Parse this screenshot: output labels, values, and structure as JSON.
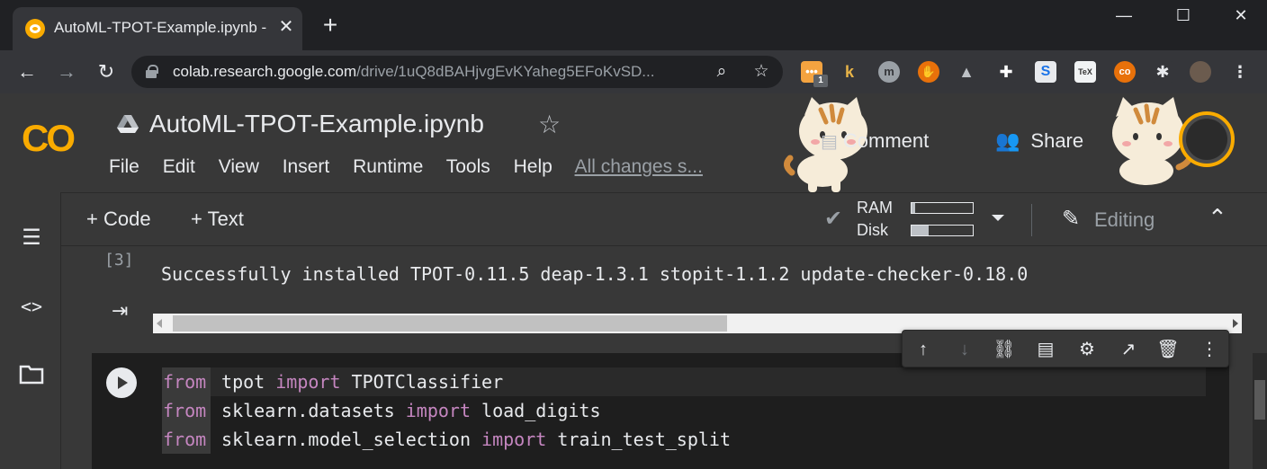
{
  "browser": {
    "tab_title": "AutoML-TPOT-Example.ipynb - C",
    "url_host": "colab.research.google.com",
    "url_path": "/drive/1uQ8dBAHjvgEvKYaheg5EFoKvSD...",
    "extension_badge": "1",
    "extensions": [
      "k",
      "m",
      "TeX"
    ]
  },
  "colab": {
    "logo_text": "CO",
    "notebook_title": "AutoML-TPOT-Example.ipynb",
    "menu": [
      "File",
      "Edit",
      "View",
      "Insert",
      "Runtime",
      "Tools",
      "Help"
    ],
    "save_status": "All changes s...",
    "comment_label": "Comment",
    "share_label": "Share",
    "accent_color": "#f9ab00"
  },
  "toolbar": {
    "add_code": "+ Code",
    "add_text": "+ Text",
    "ram_label": "RAM",
    "disk_label": "Disk",
    "ram_usage": 0.06,
    "disk_usage": 0.28,
    "editing_label": "Editing"
  },
  "output_cell": {
    "exec_count": "[3]",
    "text": "Successfully installed TPOT-0.11.5 deap-1.3.1 stopit-1.1.2 update-checker-0.18.0",
    "hscroll_position": 0.52
  },
  "code_cell": {
    "lines": [
      {
        "kw1": "from",
        "mod": " tpot ",
        "kw2": "import",
        "name": " TPOTClassifier"
      },
      {
        "kw1": "from",
        "mod": " sklearn.datasets ",
        "kw2": "import",
        "name": " load_digits"
      },
      {
        "kw1": "from",
        "mod": " sklearn.model_selection ",
        "kw2": "import",
        "name": " train_test_split"
      }
    ]
  },
  "icons": {
    "cell_actions": [
      "arrow-up-icon",
      "arrow-down-icon",
      "link-icon",
      "comment-icon",
      "settings-icon",
      "open-in-new-icon",
      "delete-icon",
      "more-vert-icon"
    ],
    "sidebar": [
      "table-of-contents-icon",
      "code-snippets-icon",
      "files-icon"
    ]
  }
}
